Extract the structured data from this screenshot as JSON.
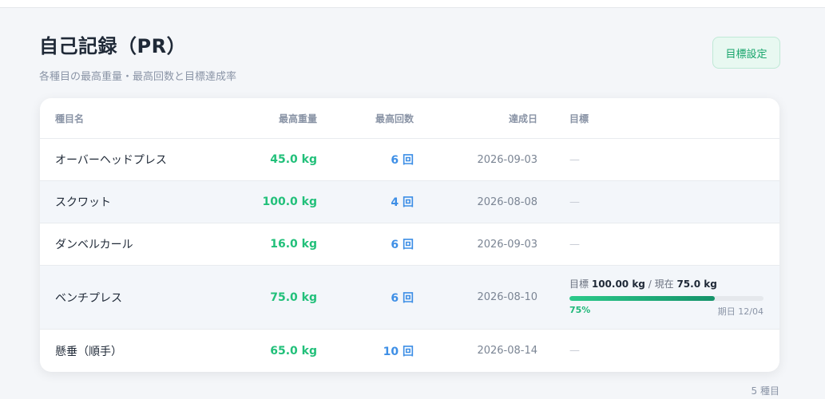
{
  "header": {
    "title": "自己記録（PR）",
    "subtitle": "各種目の最高重量・最高回数と目標達成率",
    "goal_button": "目標設定"
  },
  "table": {
    "columns": {
      "name": "種目名",
      "max_weight": "最高重量",
      "max_reps": "最高回数",
      "date": "達成日",
      "goal": "目標"
    },
    "rows": [
      {
        "name": "オーバーヘッドプレス",
        "weight": "45.0 kg",
        "reps": "6 回",
        "date": "2026-09-03",
        "goal": "—"
      },
      {
        "name": "スクワット",
        "weight": "100.0 kg",
        "reps": "4 回",
        "date": "2026-08-08",
        "goal": "—"
      },
      {
        "name": "ダンベルカール",
        "weight": "16.0 kg",
        "reps": "6 回",
        "date": "2026-09-03",
        "goal": "—"
      },
      {
        "name": "ベンチプレス",
        "weight": "75.0 kg",
        "reps": "6 回",
        "date": "2026-08-10",
        "goal_detail": {
          "label": "目標",
          "target": "100.00 kg",
          "separator": "/",
          "current_label": "現在",
          "current": "75.0 kg",
          "percent_label": "75%",
          "progress": 0.75,
          "due": "期日 12/04"
        }
      },
      {
        "name": "懸垂（順手）",
        "weight": "65.0 kg",
        "reps": "10 回",
        "date": "2026-08-14",
        "goal": "—"
      }
    ]
  },
  "footer": {
    "count": "5 種目"
  },
  "colors": {
    "accent_green": "#22c07a",
    "accent_blue": "#3e8fe6",
    "progress_start": "#2bc98a",
    "progress_end": "#15936a"
  }
}
